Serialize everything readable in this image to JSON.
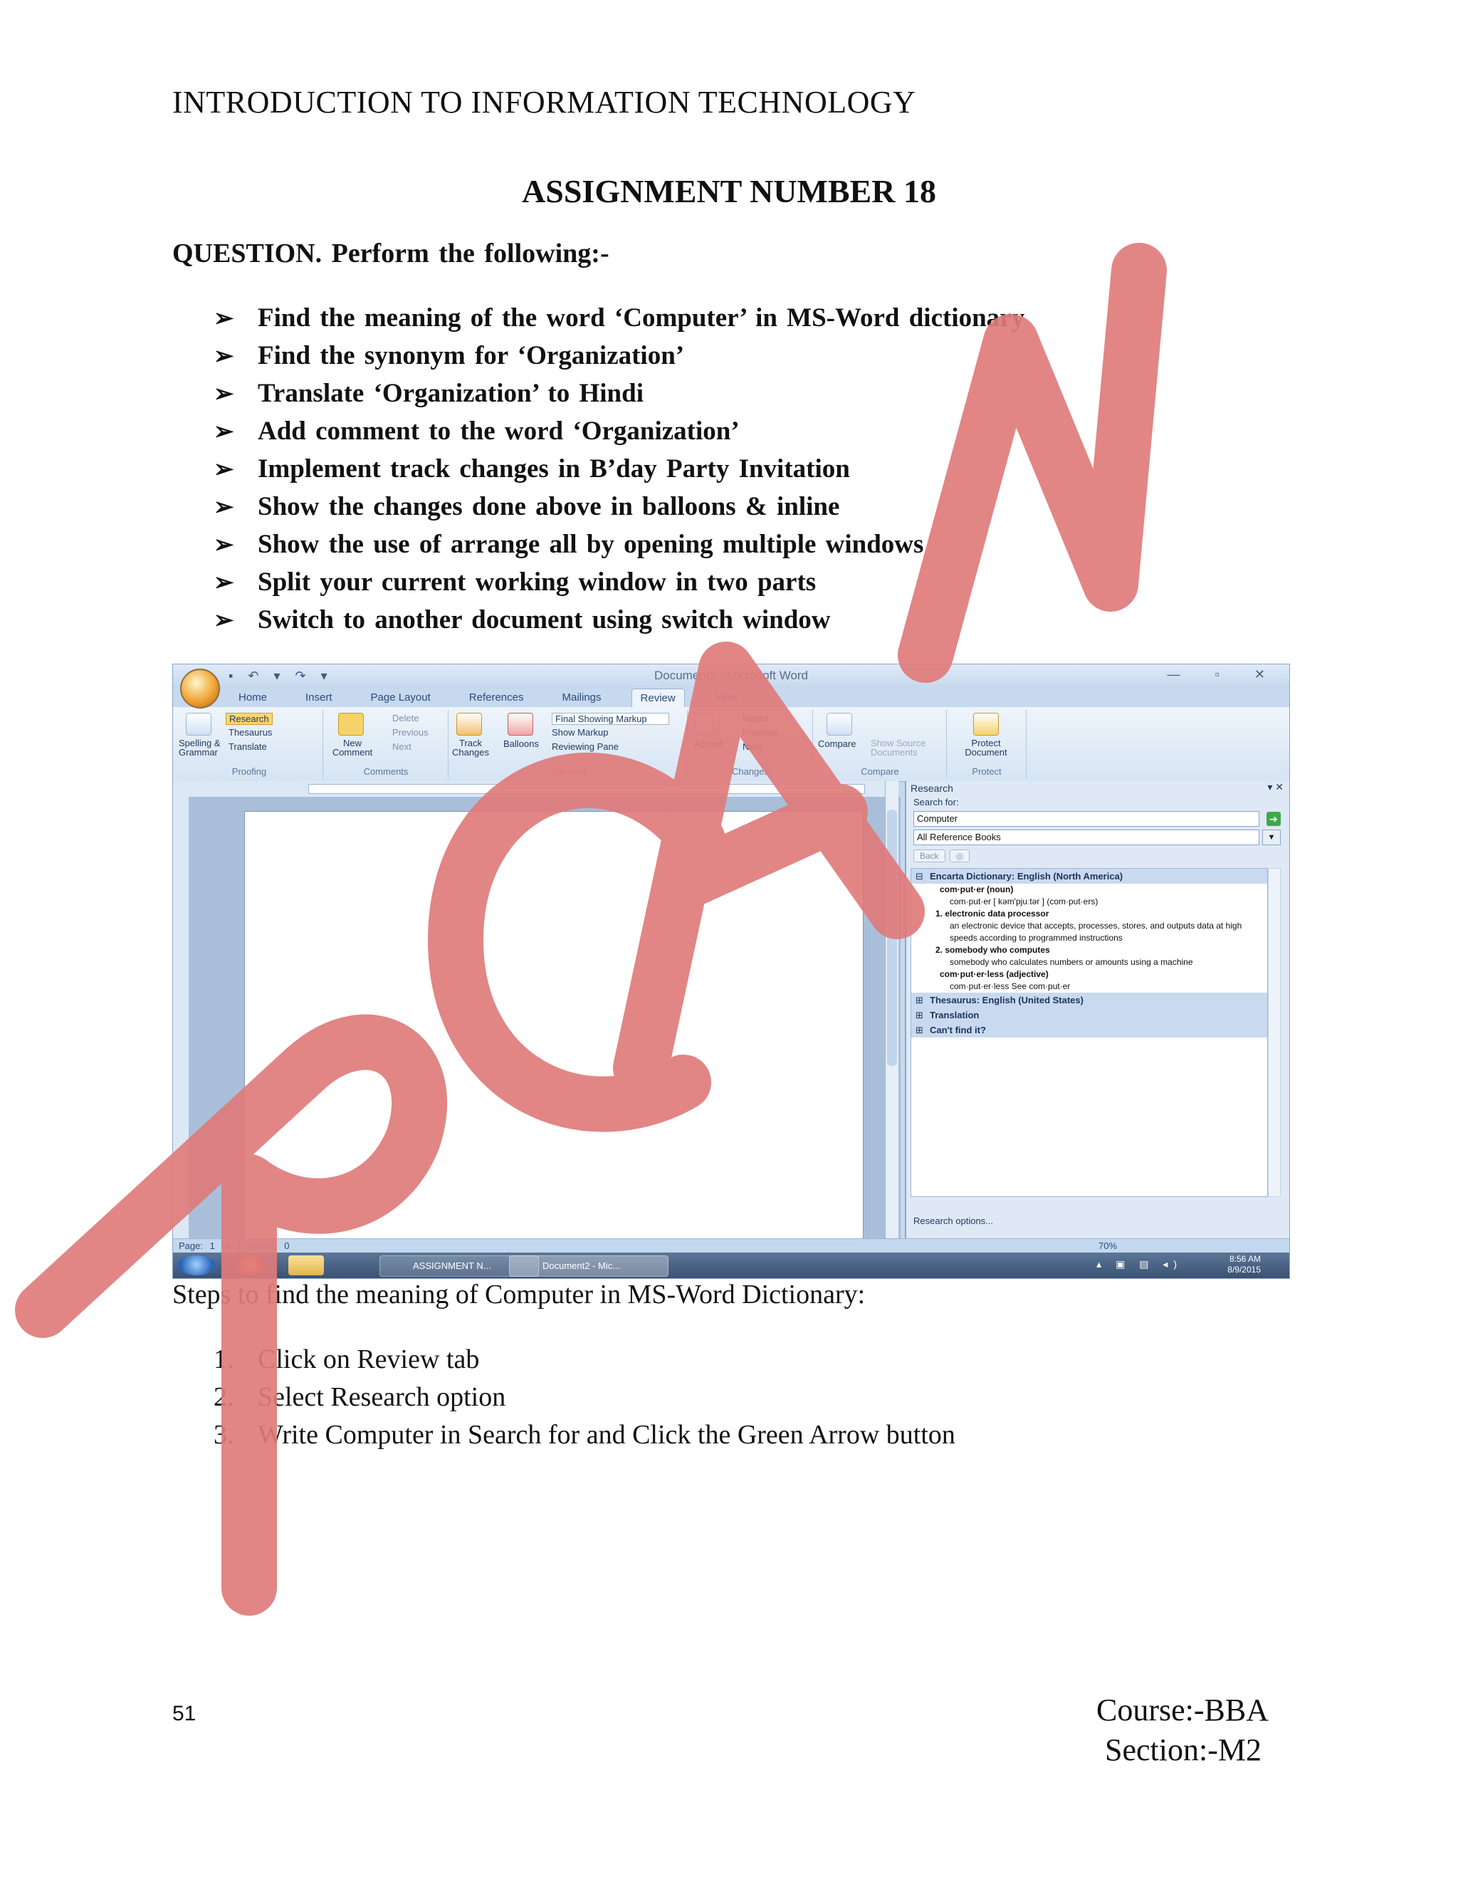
{
  "page": {
    "header": "INTRODUCTION TO INFORMATION TECHNOLOGY",
    "assignment_title": "ASSIGNMENT NUMBER 18",
    "question": "QUESTION. Perform the following:-",
    "tasks": [
      "Find the meaning of the word ‘Computer’ in MS-Word dictionary",
      "Find the synonym for ‘Organization’",
      "Translate ‘Organization’ to Hindi",
      "Add comment to the word ‘Organization’",
      "Implement track changes in B’day Party Invitation",
      "Show the changes done above in balloons & inline",
      "Show the use of arrange all by opening multiple windows",
      "Split your current working window in two parts",
      "Switch to another document using switch window"
    ],
    "bullet": "➢",
    "steps_intro": "Steps to find the meaning of Computer in MS-Word Dictionary:",
    "steps": [
      {
        "num": "1.",
        "text": "Click on Review tab"
      },
      {
        "num": "2.",
        "text": "Select Research option"
      },
      {
        "num": "3.",
        "text": "Write Computer in Search for and Click the Green Arrow button"
      }
    ],
    "page_number": "51",
    "course": "Course:-BBA",
    "section": "Section:-M2",
    "watermark_text": "RCAN",
    "watermark_color": "#e07b7b"
  },
  "screenshot": {
    "window_title": "Document2 - Microsoft Word",
    "quick_access": "▪ ↶ ▾ ↷ ▾",
    "window_controls": "— ▫ ✕",
    "tabs": [
      {
        "label": "Home",
        "active": false
      },
      {
        "label": "Insert",
        "active": false
      },
      {
        "label": "Page Layout",
        "active": false
      },
      {
        "label": "References",
        "active": false
      },
      {
        "label": "Mailings",
        "active": false
      },
      {
        "label": "Review",
        "active": true
      },
      {
        "label": "View",
        "active": false
      }
    ],
    "ribbon": {
      "proofing": {
        "label": "Proofing",
        "spelling": "Spelling & Grammar",
        "research": "Research",
        "thesaurus": "Thesaurus",
        "translate": "Translate"
      },
      "comments": {
        "label": "Comments",
        "new_comment": "New Comment",
        "delete": "Delete",
        "previous": "Previous",
        "next": "Next"
      },
      "tracking": {
        "label": "Tracking",
        "track_changes": "Track Changes",
        "balloons": "Balloons",
        "markup_select": "Final Showing Markup",
        "show_markup": "Show Markup",
        "reviewing_pane": "Reviewing Pane"
      },
      "changes": {
        "label": "Changes",
        "accept": "Accept",
        "reject": "Reject",
        "previous": "Previous",
        "next": "Next"
      },
      "compare": {
        "label": "Compare",
        "compare": "Compare",
        "show_source": "Show Source Documents"
      },
      "protect": {
        "label": "Protect",
        "protect_document": "Protect Document"
      }
    },
    "research_pane": {
      "title": "Research",
      "close": "▾ ✕",
      "search_for_label": "Search for:",
      "search_value": "Computer",
      "go_arrow": "➔",
      "source": "All Reference Books",
      "back": "Back",
      "nav_icon": "◎",
      "results": {
        "encarta_header": "Encarta Dictionary: English (North America)",
        "entry1": "com·put·er (noun)",
        "pron": "com·put·er [ kəm'pjuːtər ] (com·put·ers)",
        "def1_title": "1. electronic data processor",
        "def1_text": "an electronic device that accepts, processes, stores, and outputs data at high speeds according to programmed instructions",
        "def2_title": "2. somebody who computes",
        "def2_text": "somebody who calculates numbers or amounts using a machine",
        "entry2": "com·put·er·less (adjective)",
        "entry2_text": "com·put·er·less See com·put·er",
        "thesaurus_header": "Thesaurus: English (United States)",
        "translation_header": "Translation",
        "cantfind_header": "Can't find it?"
      },
      "options": "Research options..."
    },
    "status": {
      "left": "Page: 1 of 1   Words: 0",
      "zoom": "70%"
    },
    "taskbar": {
      "app1": "ASSIGNMENT N...",
      "app2": "Document2 - Mic...",
      "time": "8:56 AM",
      "date": "8/9/2015"
    }
  }
}
